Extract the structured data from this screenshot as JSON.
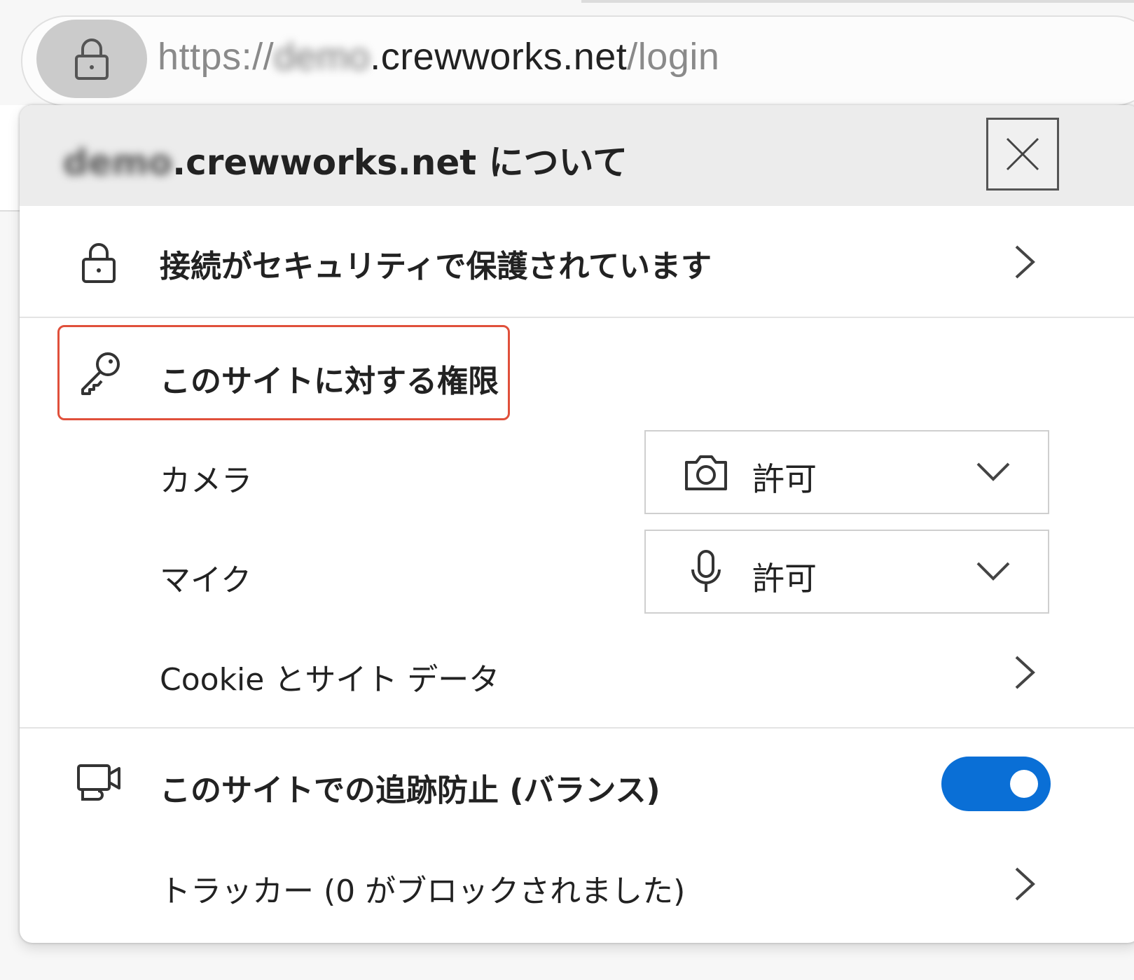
{
  "address_bar": {
    "scheme": "https://",
    "blurred": "demo",
    "host": ".crewworks.net",
    "path": "/login"
  },
  "page": {
    "bracket": "【"
  },
  "flyout": {
    "title_blurred": "demo",
    "title_rest": ".crewworks.net について",
    "close_icon": "close-icon",
    "connection": {
      "label": "接続がセキュリティで保護されています",
      "icon": "lock-icon"
    },
    "permissions": {
      "heading": "このサイトに対する権限",
      "icon": "key-icon",
      "camera": {
        "label": "カメラ",
        "value": "許可",
        "icon": "camera-icon"
      },
      "mic": {
        "label": "マイク",
        "value": "許可",
        "icon": "microphone-icon"
      },
      "cookies": {
        "label": "Cookie とサイト データ"
      }
    },
    "tracking": {
      "label": "このサイトでの追跡防止 (バランス)",
      "icon": "tracking-prevention-icon",
      "enabled": true,
      "toggle_color": "#0a6fd6"
    },
    "trackers": {
      "label": "トラッカー (0 がブロックされました)"
    },
    "highlight_color": "#e0503b"
  }
}
